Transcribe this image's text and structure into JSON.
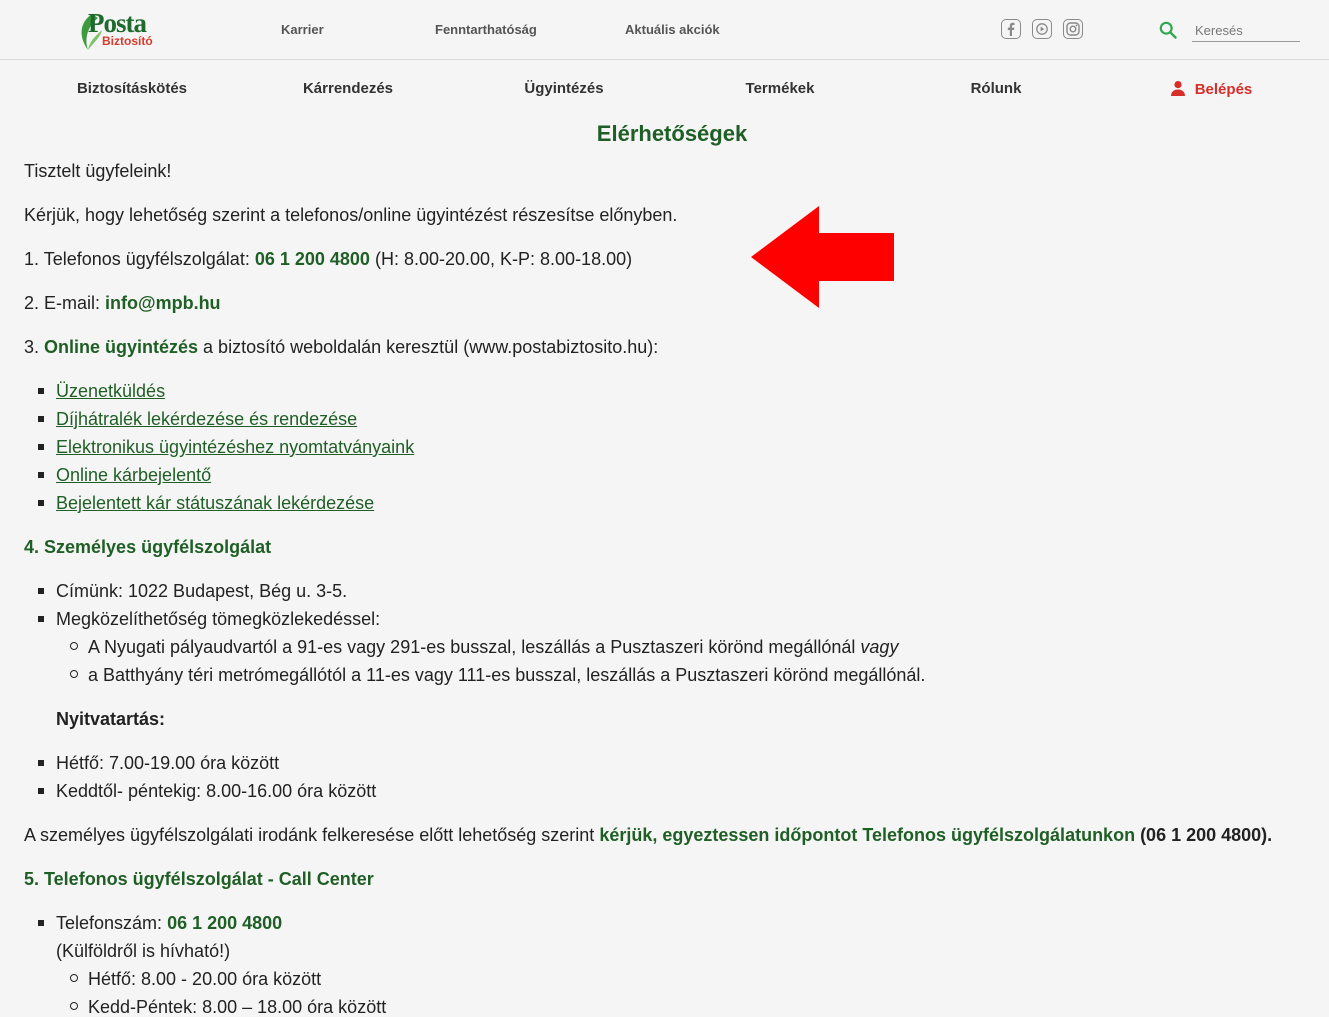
{
  "header": {
    "logo": {
      "brand": "Posta",
      "sub": "Biztosító"
    },
    "top_links": [
      "Karrier",
      "Fenntarthatóság",
      "Aktuális akciók"
    ],
    "social_icons": [
      "facebook-icon",
      "youtube-icon",
      "instagram-icon"
    ],
    "search": {
      "placeholder": "Keresés",
      "value": ""
    }
  },
  "nav": {
    "items": [
      "Biztosításkötés",
      "Kárrendezés",
      "Ügyintézés",
      "Termékek",
      "Rólunk"
    ],
    "login": "Belépés"
  },
  "colors": {
    "brand_green": "#1f5f25",
    "accent_red": "#d62f2a",
    "arrow_red": "#ff0000"
  },
  "content": {
    "title": "Elérhetőségek",
    "greeting": "Tisztelt ügyfeleink!",
    "intro": "Kérjük, hogy lehetőség szerint a telefonos/online ügyintézést részesítse előnyben.",
    "phone_line": {
      "prefix": "1. Telefonos ügyfélszolgálat: ",
      "number": "06 1 200 4800",
      "suffix": " (H: 8.00-20.00, K-P: 8.00-18.00)"
    },
    "email_line": {
      "prefix": "2. E-mail: ",
      "email": "info@mpb.hu"
    },
    "online_line": {
      "prefix": "3. ",
      "strong": "Online ügyintézés",
      "suffix": " a biztosító weboldalán keresztül (www.postabiztosito.hu):"
    },
    "online_links": [
      "Üzenetküldés",
      "Díjhátralék lekérdezése és rendezése",
      "Elektronikus ügyintézéshez nyomtatványaink",
      "Online kárbejelentő",
      "Bejelentett kár státuszának lekérdezése"
    ],
    "section4": {
      "heading": "4. Személyes ügyfélszolgálat",
      "address": "Címünk: 1022 Budapest, Bég u. 3-5.",
      "transport": "Megközelíthetőség tömegközlekedéssel:",
      "transport_opt1": "A Nyugati pályaudvartól a 91-es vagy 291-es busszal, leszállás a Pusztaszeri körönd megállónál ",
      "transport_opt1_italic": "vagy",
      "transport_opt2": "a Batthyány téri metrómegállótól a 11-es vagy 111-es busszal, leszállás a Pusztaszeri körönd megállónál.",
      "hours_heading": "Nyitvatartás:",
      "hours": [
        "Hétfő: 7.00-19.00 óra között",
        "Keddtől- péntekig: 8.00-16.00 óra között"
      ],
      "note_prefix": "A személyes ügyfélszolgálati irodánk felkeresése előtt lehetőség szerint ",
      "note_strong": "kérjük, egyeztessen időpontot Telefonos ügyfélszolgálatunkon",
      "note_suffix": " (06 1 200 4800)."
    },
    "section5": {
      "heading": "5. Telefonos ügyfélszolgálat - Call Center",
      "phone_prefix": "Telefonszám: ",
      "phone_number": "06 1 200 4800",
      "abroad": "(Külföldről is hívható!)",
      "hours": [
        "Hétfő: 8.00 - 20.00 óra között",
        "Kedd-Péntek: 8.00 – 18.00 óra között"
      ]
    }
  }
}
